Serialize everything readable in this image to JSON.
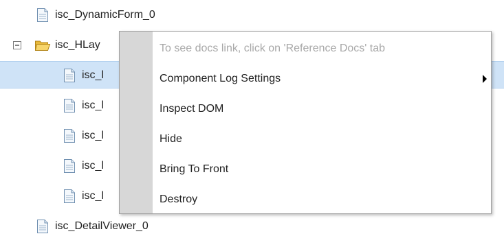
{
  "tree": {
    "nodes": [
      {
        "label": "isc_DynamicForm_0"
      },
      {
        "label": "isc_HLay"
      },
      {
        "label": "isc_l"
      },
      {
        "label": "isc_l"
      },
      {
        "label": "isc_l"
      },
      {
        "label": "isc_l"
      },
      {
        "label": "isc_l"
      },
      {
        "label": "isc_DetailViewer_0"
      }
    ]
  },
  "context_menu": {
    "hint": "To see docs link, click on 'Reference Docs' tab",
    "items": [
      {
        "label": "Component Log Settings",
        "has_submenu": true
      },
      {
        "label": "Inspect DOM"
      },
      {
        "label": "Hide"
      },
      {
        "label": "Bring To Front"
      },
      {
        "label": "Destroy"
      }
    ]
  },
  "colors": {
    "selection": "#cfe3f7",
    "menu_gutter": "#d7d7d7",
    "disabled_text": "#a8a8a8"
  }
}
